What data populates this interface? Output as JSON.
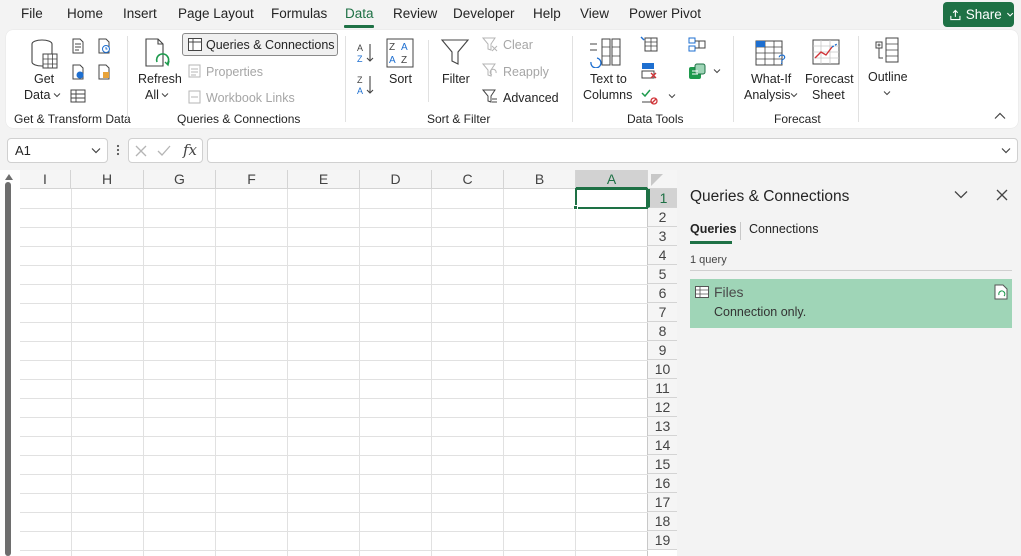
{
  "menu": {
    "items": [
      "File",
      "Home",
      "Insert",
      "Page Layout",
      "Formulas",
      "Data",
      "Review",
      "Developer",
      "Help",
      "View",
      "Power Pivot"
    ],
    "active": "Data",
    "share_label": "Share"
  },
  "ribbon": {
    "get_data": {
      "line1": "Get",
      "line2": "Data"
    },
    "refresh_all": {
      "line1": "Refresh",
      "line2": "All"
    },
    "queries_connections": "Queries & Connections",
    "properties": "Properties",
    "workbook_links": "Workbook Links",
    "sort": "Sort",
    "filter": "Filter",
    "clear": "Clear",
    "reapply": "Reapply",
    "advanced": "Advanced",
    "text_to_columns": {
      "line1": "Text to",
      "line2": "Columns"
    },
    "what_if": {
      "line1": "What-If",
      "line2": "Analysis"
    },
    "forecast_sheet": {
      "line1": "Forecast",
      "line2": "Sheet"
    },
    "outline": "Outline",
    "groups": {
      "get_transform": "Get & Transform Data",
      "queries_connections": "Queries & Connections",
      "sort_filter": "Sort & Filter",
      "data_tools": "Data Tools",
      "forecast": "Forecast"
    }
  },
  "formula_bar": {
    "name_box": "A1",
    "fx": "fx",
    "formula": ""
  },
  "sheet": {
    "columns": [
      "I",
      "H",
      "G",
      "F",
      "E",
      "D",
      "C",
      "B",
      "A"
    ],
    "rows": [
      "1",
      "2",
      "3",
      "4",
      "5",
      "6",
      "7",
      "8",
      "9",
      "10",
      "11",
      "12",
      "13",
      "14",
      "15",
      "16",
      "17",
      "18",
      "19"
    ],
    "selected_column": "A",
    "selected_row": "1"
  },
  "pane": {
    "title": "Queries & Connections",
    "tabs": [
      "Queries",
      "Connections"
    ],
    "active_tab": "Queries",
    "count_label": "1 query",
    "queries": [
      {
        "name": "Files",
        "description": "Connection only."
      }
    ]
  },
  "colors": {
    "accent": "#1e7145",
    "query_highlight": "#9fd5b7"
  }
}
